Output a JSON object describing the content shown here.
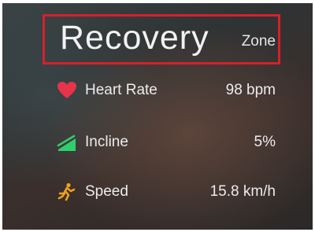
{
  "colors": {
    "highlight_box": "#d7202a",
    "heart": "#e8334a",
    "incline": "#2fcf6e",
    "speed": "#f0a21a",
    "text": "#ececec"
  },
  "zone": {
    "title": "Recovery",
    "label": "Zone"
  },
  "metrics": [
    {
      "icon": "heart-icon",
      "label": "Heart Rate",
      "value": "98 bpm"
    },
    {
      "icon": "incline-icon",
      "label": "Incline",
      "value": "5%"
    },
    {
      "icon": "runner-icon",
      "label": "Speed",
      "value": "15.8 km/h"
    }
  ]
}
